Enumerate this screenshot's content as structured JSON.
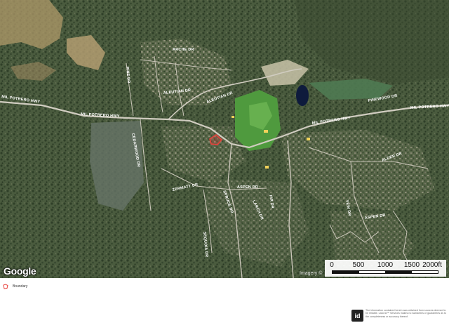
{
  "map": {
    "logo": "Google",
    "attribution": "Imagery ©",
    "scale": {
      "labels": [
        "0",
        "500",
        "1000",
        "1500",
        "2000ft"
      ],
      "segment_colors": [
        "#111111",
        "#ffffff",
        "#111111",
        "#ffffff"
      ]
    },
    "road_labels": [
      "MIL POTRERO HWY",
      "MIL POTRERO HWY",
      "MIL POTRERO HWY",
      "MIL POTRERO HWY",
      "ALEUTIAN DR",
      "ALEUTIAN DR",
      "ARCHE DR",
      "CEDARWOOD DR",
      "ZERMATT DR",
      "PINEWOOD DR",
      "ASPEN DR",
      "ASPEN DR",
      "SPRUCE DR",
      "FIR DR",
      "LARCH DR",
      "SEQUOIA DR",
      "YEW DR",
      "PINE DR",
      "ALDER DR"
    ],
    "colors": {
      "boundary": "#e8413c",
      "forest": "#3f5334",
      "meadow": "#b49c6c",
      "water": "#0e1b3c",
      "golf": "#4f9a3e",
      "road": "#d0ccc0"
    }
  },
  "legend": {
    "label": "Boundary",
    "color": "#e8413c"
  },
  "footer": {
    "logo_text": "id",
    "disclaimer": "The information contained herein was obtained from sources deemed to be reliable. Land id™ Services makes no warranties or guarantees as to the completeness or accuracy thereof."
  }
}
